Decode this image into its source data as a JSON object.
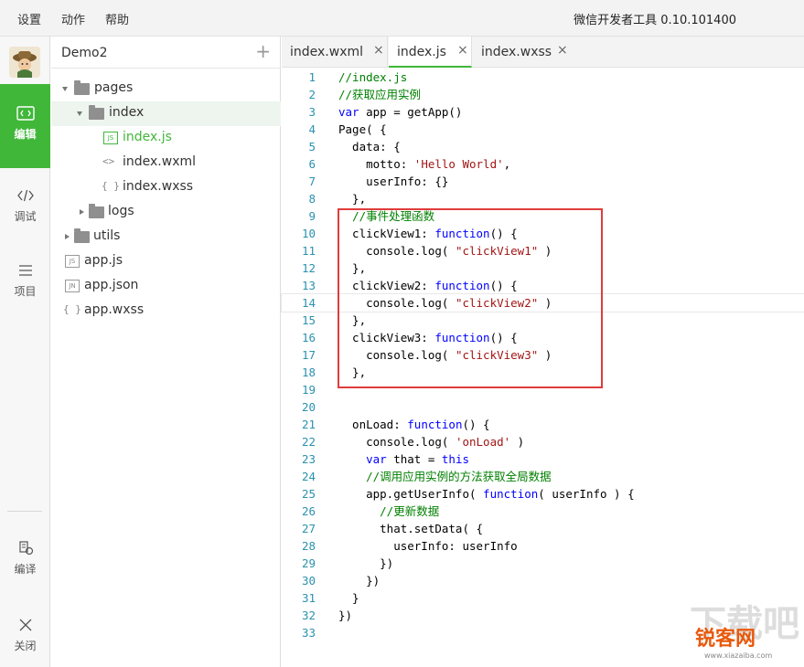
{
  "menu": {
    "settings": "设置",
    "action": "动作",
    "help": "帮助",
    "app_title": "微信开发者工具 0.10.101400"
  },
  "activity": {
    "edit": "编辑",
    "debug": "调试",
    "project": "项目",
    "compile": "编译",
    "close": "关闭"
  },
  "tree": {
    "project": "Demo2",
    "add": "+",
    "nodes": [
      {
        "label": "pages"
      },
      {
        "label": "index"
      },
      {
        "label": "index.js",
        "badge": "JS"
      },
      {
        "label": "index.wxml",
        "badge": "<>"
      },
      {
        "label": "index.wxss",
        "badge": "{ }"
      },
      {
        "label": "logs"
      },
      {
        "label": "utils"
      },
      {
        "label": "app.js",
        "badge": "JS"
      },
      {
        "label": "app.json",
        "badge": "JN"
      },
      {
        "label": "app.wxss",
        "badge": "{ }"
      }
    ]
  },
  "tabs": [
    {
      "label": "index.wxml",
      "close": "×"
    },
    {
      "label": "index.js",
      "close": "×"
    },
    {
      "label": "index.wxss",
      "close": "×"
    }
  ],
  "code": [
    "//index.js",
    "//获取应用实例",
    "var app = getApp()",
    "Page( {",
    "  data: {",
    "    motto: 'Hello World',",
    "    userInfo: {}",
    "  },",
    "  //事件处理函数",
    "  clickView1: function() {",
    "    console.log( \"clickView1\" )",
    "  },",
    "  clickView2: function() {",
    "    console.log( \"clickView2\" )",
    "  },",
    "  clickView3: function() {",
    "    console.log( \"clickView3\" )",
    "  },",
    "",
    "",
    "  onLoad: function() {",
    "    console.log( 'onLoad' )",
    "    var that = this",
    "    //调用应用实例的方法获取全局数据",
    "    app.getUserInfo( function( userInfo ) {",
    "      //更新数据",
    "      that.setData( {",
    "        userInfo: userInfo",
    "      })",
    "    })",
    "  }",
    "})",
    ""
  ],
  "watermark": {
    "text": "锐客网",
    "sub": "www.xiazaiba.com"
  },
  "colors": {
    "accent": "#41b739",
    "box": "#e03c3c"
  }
}
